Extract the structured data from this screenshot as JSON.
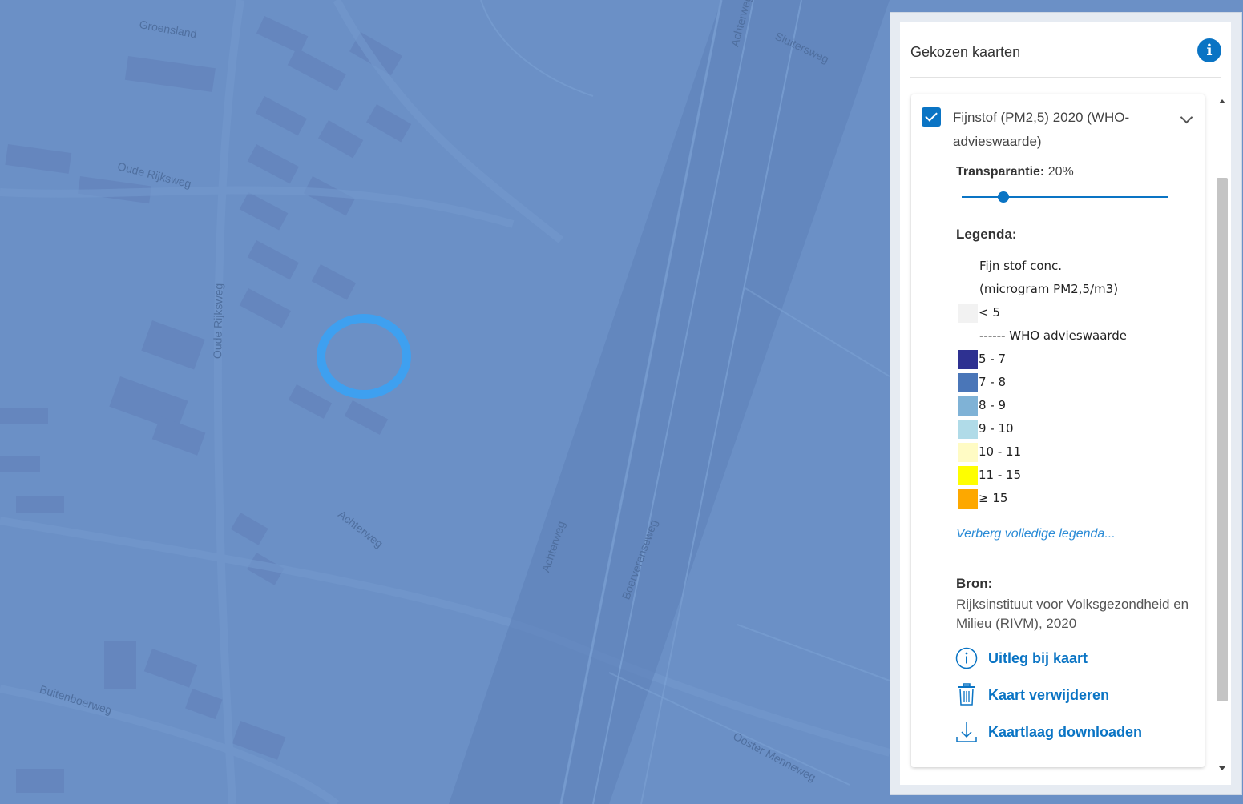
{
  "map": {
    "streets": [
      {
        "name": "Groensland"
      },
      {
        "name": "Sluitersweg"
      },
      {
        "name": "Achterweg"
      },
      {
        "name": "Oude Rijksweg"
      },
      {
        "name": "Oude Rijksweg"
      },
      {
        "name": "Achterweg"
      },
      {
        "name": "Achterweg"
      },
      {
        "name": "Boerverenseweg"
      },
      {
        "name": "Buitenboerweg"
      },
      {
        "name": "Ooster Menneweg"
      }
    ]
  },
  "panel": {
    "title": "Gekozen kaarten",
    "info_icon": "info-icon",
    "layer": {
      "checked": true,
      "title": "Fijnstof (PM2,5) 2020 (WHO-advieswaarde)",
      "transparency_label": "Transparantie:",
      "transparency_value": "20%",
      "transparency_fraction": 0.2,
      "legend_title": "Legenda:",
      "legend": [
        {
          "label": "Fijn stof conc.",
          "color": ""
        },
        {
          "label": "(microgram PM2,5/m3)",
          "color": ""
        },
        {
          "label": "< 5",
          "color": "#f2f2f2"
        },
        {
          "label": "------ WHO advieswaarde",
          "color": ""
        },
        {
          "label": "5 - 7",
          "color": "#2e3191"
        },
        {
          "label": "7 - 8",
          "color": "#4a76b8"
        },
        {
          "label": "8 - 9",
          "color": "#7fb2d6"
        },
        {
          "label": "9 - 10",
          "color": "#b0dbe8"
        },
        {
          "label": "10 - 11",
          "color": "#fffbc4"
        },
        {
          "label": "11 - 15",
          "color": "#fefe00"
        },
        {
          "label": "≥ 15",
          "color": "#fda800"
        }
      ],
      "hide_legend_link": "Verberg volledige legenda...",
      "source_title": "Bron:",
      "source_text": "Rijksinstituut voor Volksgezondheid en Milieu (RIVM), 2020",
      "actions": [
        {
          "label": "Uitleg bij kaart",
          "icon": "info-circle-icon"
        },
        {
          "label": "Kaart verwijderen",
          "icon": "trash-icon"
        },
        {
          "label": "Kaartlaag downloaden",
          "icon": "download-icon"
        }
      ]
    }
  },
  "colors": {
    "map_background": "#6b90c6",
    "accent": "#0a74c4",
    "location_ring": "#3ea0f0"
  }
}
